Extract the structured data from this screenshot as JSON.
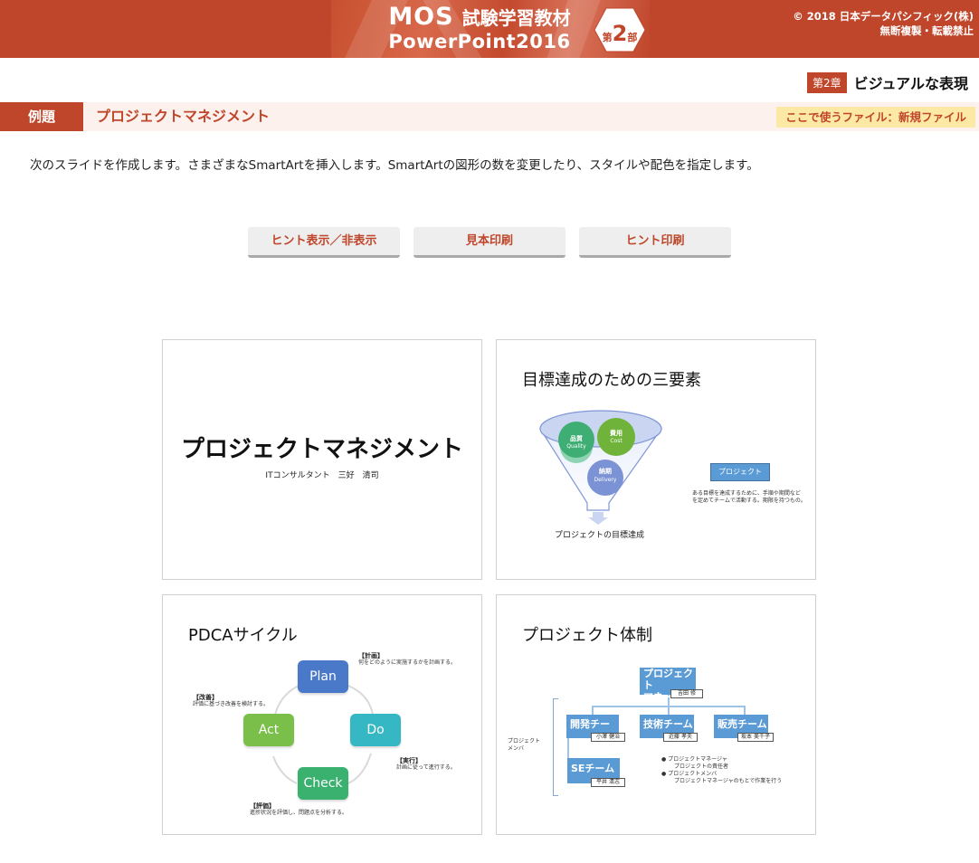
{
  "header": {
    "banner_mos": "MOS",
    "banner_sub": "試験学習教材",
    "banner_product": "PowerPoint2016",
    "part_small1": "第",
    "part_number": "2",
    "part_small2": "部",
    "copyright_line1": "© 2018 日本データパシフィック(株)",
    "copyright_line2": "無断複製・転載禁止",
    "colors": {
      "brand": "#c0462b"
    }
  },
  "chapter": {
    "badge": "第2章",
    "title": "ビジュアルな表現"
  },
  "exercise": {
    "label": "例題",
    "title": "プロジェクトマネジメント",
    "file": "ここで使うファイル：新規ファイル",
    "description": "次のスライドを作成します。さまざまなSmartArtを挿入します。SmartArtの図形の数を変更したり、スタイルや配色を指定します。"
  },
  "buttons": {
    "hint_toggle": "ヒント表示／非表示",
    "sample_print": "見本印刷",
    "hint_print": "ヒント印刷"
  },
  "slides": {
    "s1": {
      "title": "プロジェクトマネジメント",
      "subtitle": "ITコンサルタント　三好　清司"
    },
    "s2": {
      "title": "目標達成のための三要素",
      "quality": "品質",
      "quality_en": "Quality",
      "cost": "費用",
      "cost_en": "Cost",
      "delivery": "納期",
      "delivery_en": "Delivery",
      "result": "プロジェクトの目標達成",
      "project_box": "プロジェクト",
      "project_note1": "ある目標を達成するために、手順や期間など",
      "project_note2": "を定めてチームで活動する。期限を持つもの。"
    },
    "s3": {
      "title": "PDCAサイクル",
      "plan": "Plan",
      "do": "Do",
      "check": "Check",
      "act": "Act",
      "plan_note_head": "【計画】",
      "plan_note": "何をどのように実施するかを計画する。",
      "do_note_head": "【実行】",
      "do_note": "計画に従って進行する。",
      "check_note_head": "【評価】",
      "check_note": "進捗状況を評価し、問題点を分析する。",
      "act_note_head": "【改善】",
      "act_note": "評価に基づき改善を検討する。"
    },
    "s4": {
      "title": "プロジェクト体制",
      "pm_line1": "プロジェクト",
      "pm_line2": "マネージャ",
      "pm_name": "吉田 修",
      "dev": "開発チーム",
      "dev_name": "小澤 健治",
      "tech": "技術チーム",
      "tech_name": "近藤 孝夫",
      "sales": "販売チーム",
      "sales_name": "坂本 美千子",
      "se": "SEチーム",
      "se_name": "平井 清志",
      "members_line1": "プロジェクト",
      "members_line2": "メンバ",
      "legend1": "プロジェクトマネージャ",
      "legend1_sub": "プロジェクトの責任者",
      "legend2": "プロジェクトメンバ",
      "legend2_sub": "プロジェクトマネージャのもとで作業を行う"
    }
  }
}
